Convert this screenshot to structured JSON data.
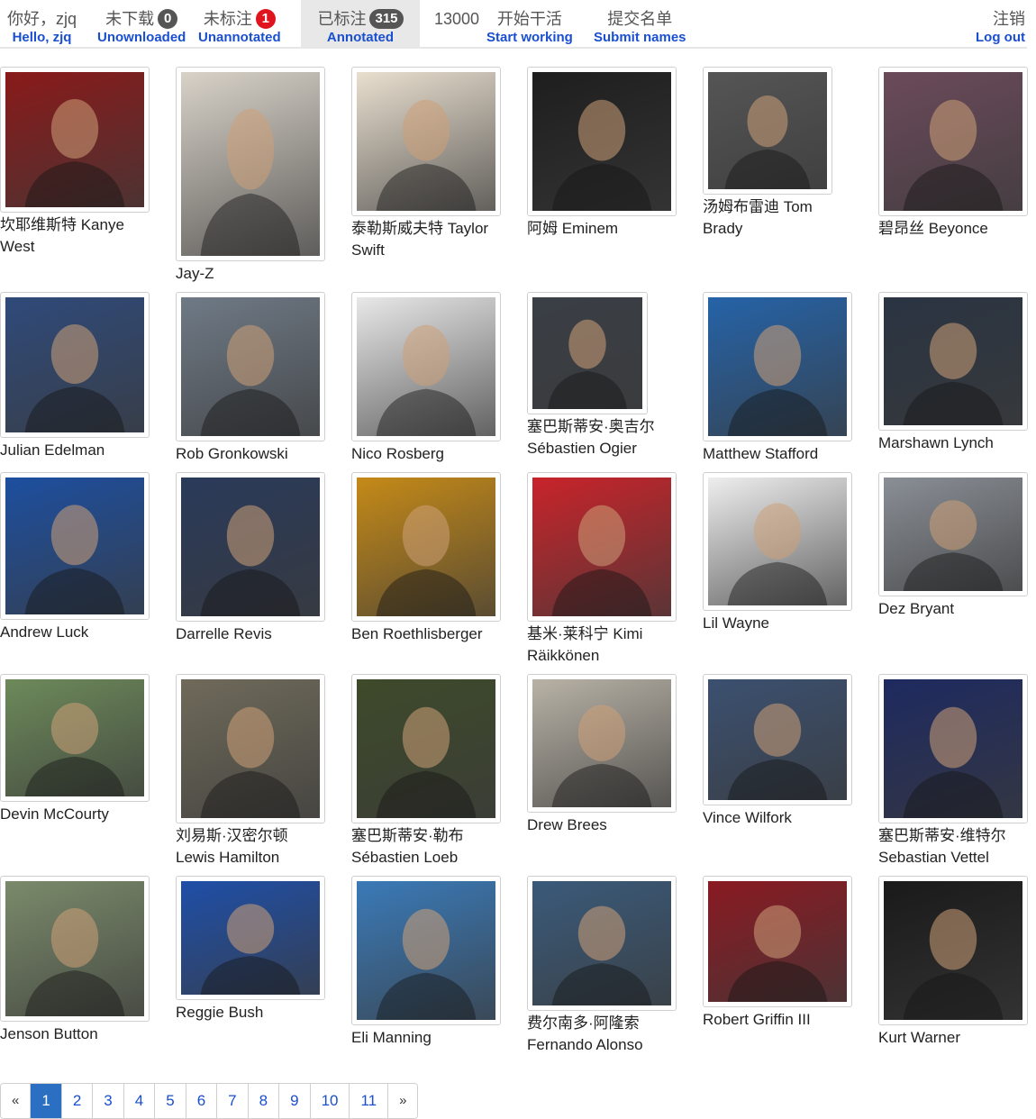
{
  "nav": {
    "greeting_zh": "你好，zjq",
    "greeting_en": "Hello, zjq",
    "unloaded_zh": "未下载",
    "unloaded_count": "0",
    "unloaded_en": "Unownloaded",
    "unannotated_zh": "未标注",
    "unannotated_count": "1",
    "unannotated_en": "Unannotated",
    "annotated_zh": "已标注",
    "annotated_count": "315",
    "annotated_en": "Annotated",
    "total": "13000",
    "start_zh": "开始干活",
    "start_en": "Start working",
    "submit_zh": "提交名单",
    "submit_en": "Submit names",
    "logout_zh": "注销",
    "logout_en": "Log out"
  },
  "people": [
    {
      "line1": "坎耶维斯特 Kanye",
      "line2": "West",
      "color": "#8a1a1a"
    },
    {
      "line1": "Jay-Z",
      "line2": "",
      "color": "#d8d2c8"
    },
    {
      "line1": "泰勒斯威夫特 Taylor",
      "line2": "Swift",
      "color": "#e9dfcf"
    },
    {
      "line1": "阿姆 Eminem",
      "line2": "",
      "color": "#1e1e1e"
    },
    {
      "line1": "汤姆布雷迪 Tom",
      "line2": "Brady",
      "color": "#555555"
    },
    {
      "line1": "碧昂丝 Beyonce",
      "line2": "",
      "color": "#6b4a5a"
    },
    {
      "line1": "Julian Edelman",
      "line2": "",
      "color": "#2f4a7a"
    },
    {
      "line1": "Rob Gronkowski",
      "line2": "",
      "color": "#6f7a86"
    },
    {
      "line1": "Nico Rosberg",
      "line2": "",
      "color": "#e8e8e8"
    },
    {
      "line1": "塞巴斯蒂安·奥吉尔",
      "line2": "Sébastien Ogier",
      "color": "#3a3f46"
    },
    {
      "line1": "Matthew Stafford",
      "line2": "",
      "color": "#2563a8"
    },
    {
      "line1": "Marshawn Lynch",
      "line2": "",
      "color": "#2a3442"
    },
    {
      "line1": "Andrew Luck",
      "line2": "",
      "color": "#1d4fa0"
    },
    {
      "line1": "Darrelle Revis",
      "line2": "",
      "color": "#2a3a5a"
    },
    {
      "line1": "Ben Roethlisberger",
      "line2": "",
      "color": "#c58a18"
    },
    {
      "line1": "基米·莱科宁 Kimi",
      "line2": "Räikkönen",
      "color": "#c8242a"
    },
    {
      "line1": "Lil Wayne",
      "line2": "",
      "color": "#eeeeee"
    },
    {
      "line1": "Dez Bryant",
      "line2": "",
      "color": "#8a8f96"
    },
    {
      "line1": "Devin McCourty",
      "line2": "",
      "color": "#6d8a5a"
    },
    {
      "line1": "刘易斯·汉密尔顿",
      "line2": "Lewis Hamilton",
      "color": "#6f6a5a"
    },
    {
      "line1": "塞巴斯蒂安·勒布",
      "line2": "Sébastien Loeb",
      "color": "#3e4a2a"
    },
    {
      "line1": "Drew Brees",
      "line2": "",
      "color": "#b8b2a6"
    },
    {
      "line1": "Vince Wilfork",
      "line2": "",
      "color": "#3b5070"
    },
    {
      "line1": "塞巴斯蒂安·维特尔",
      "line2": "Sebastian Vettel",
      "color": "#1e2a60"
    },
    {
      "line1": "Jenson Button",
      "line2": "",
      "color": "#7a8a6a"
    },
    {
      "line1": "Reggie Bush",
      "line2": "",
      "color": "#1f4fa8"
    },
    {
      "line1": "Eli Manning",
      "line2": "",
      "color": "#3a7ab8"
    },
    {
      "line1": "费尔南多·阿隆索",
      "line2": "Fernando Alonso",
      "color": "#3a5a7a"
    },
    {
      "line1": "Robert Griffin III",
      "line2": "",
      "color": "#8a1a22"
    },
    {
      "line1": "Kurt Warner",
      "line2": "",
      "color": "#1a1a1a"
    }
  ],
  "pagination": {
    "prev": "«",
    "pages": [
      "1",
      "2",
      "3",
      "4",
      "5",
      "6",
      "7",
      "8",
      "9",
      "10",
      "11"
    ],
    "next": "»"
  }
}
